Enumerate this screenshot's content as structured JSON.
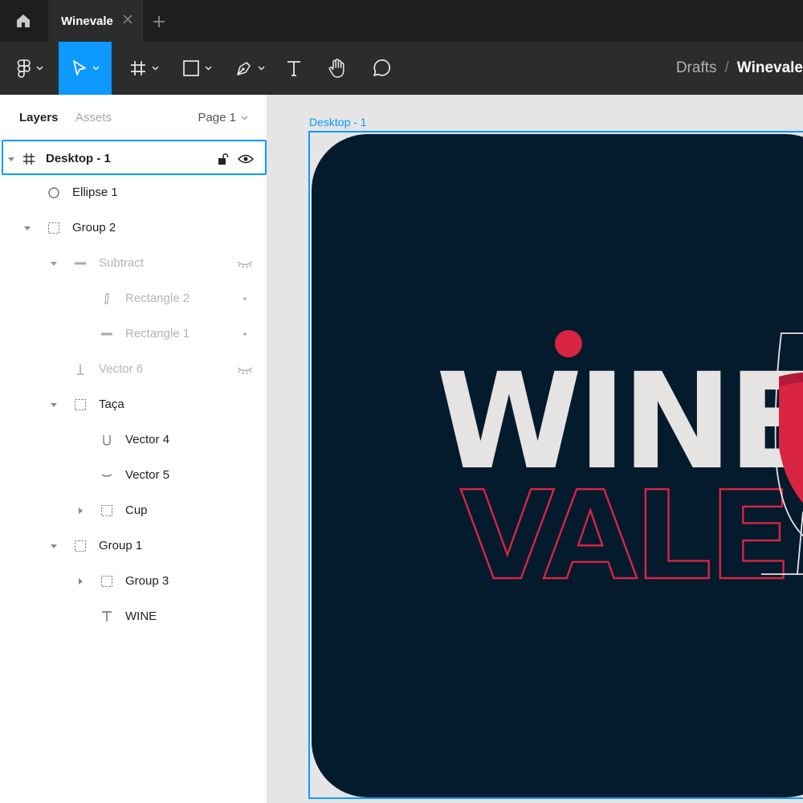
{
  "titlebar": {
    "tab_title": "Winevale"
  },
  "toolbar": {
    "breadcrumb": {
      "drafts": "Drafts",
      "separator": "/",
      "file": "Winevale"
    }
  },
  "panel": {
    "tabs": {
      "layers": "Layers",
      "assets": "Assets"
    },
    "page": "Page 1",
    "layers": [
      {
        "label": "Desktop - 1",
        "icon": "frame-icon",
        "selected": true
      },
      {
        "label": "Ellipse 1",
        "icon": "ellipse-icon"
      },
      {
        "label": "Group 2",
        "icon": "group-icon"
      },
      {
        "label": "Subtract",
        "icon": "subtract-icon",
        "hidden": true
      },
      {
        "label": "Rectangle 2",
        "icon": "rectangle-icon",
        "hidden": true
      },
      {
        "label": "Rectangle 1",
        "icon": "rectangle-icon",
        "hidden": true
      },
      {
        "label": "Vector 6",
        "icon": "vector-icon",
        "hidden": true
      },
      {
        "label": "Taça",
        "icon": "group-icon"
      },
      {
        "label": "Vector 4",
        "icon": "vector-icon"
      },
      {
        "label": "Vector 5",
        "icon": "vector-icon"
      },
      {
        "label": "Cup",
        "icon": "group-icon"
      },
      {
        "label": "Group 1",
        "icon": "group-icon"
      },
      {
        "label": "Group 3",
        "icon": "group-icon"
      },
      {
        "label": "WINE",
        "icon": "text-icon"
      }
    ]
  },
  "canvas": {
    "frame_label": "Desktop - 1",
    "artwork": {
      "word_top": "WINE",
      "word_bottom": "VALE"
    }
  },
  "colors": {
    "accent": "#0d99ff",
    "artwork_background": "#031b2c",
    "wine_red": "#d92443",
    "wine_text": "#e6e3e3"
  }
}
